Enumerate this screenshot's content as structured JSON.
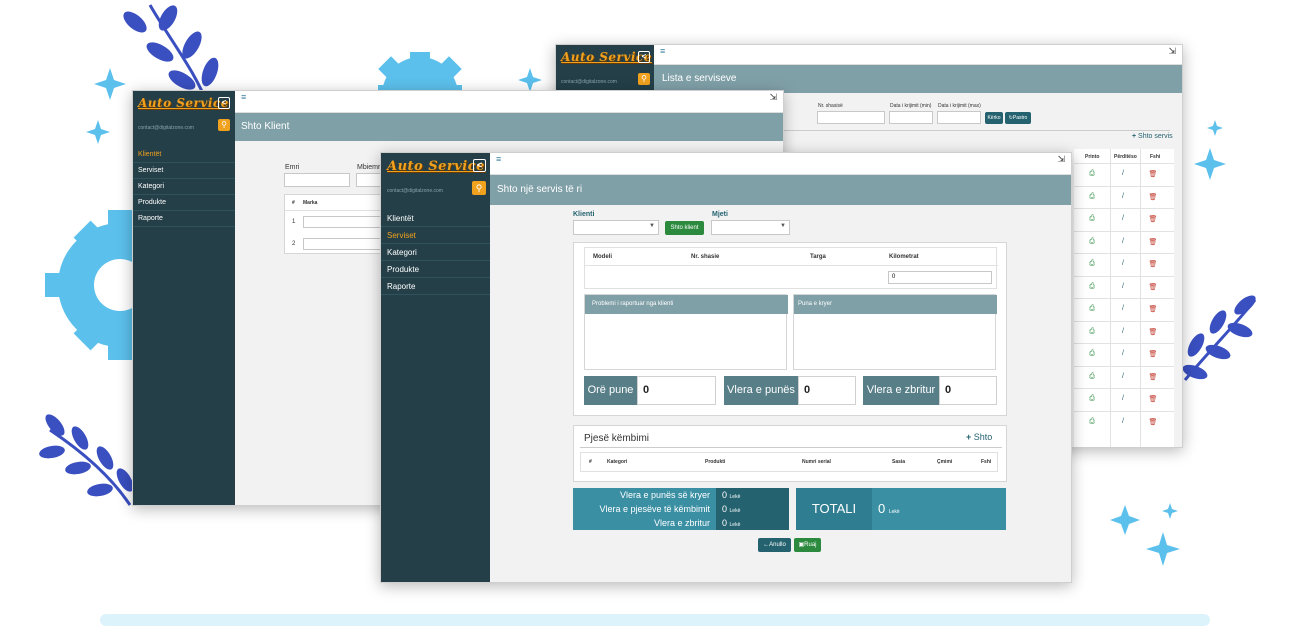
{
  "colors": {
    "sidebar": "#243f48",
    "accent_orange": "#f0a11e",
    "titlebar": "#80a0a8",
    "teal_button": "#24626f",
    "green_button": "#2b8a3e",
    "total_panel": "#3a8fa3",
    "decor_blue": "#3a4fc0",
    "decor_light": "#5cc0ec"
  },
  "brand": "Auto Service",
  "collapse_glyph": "<",
  "email": "contact@digitalzone.com",
  "search_glyph": "⚲",
  "hamburger_glyph": "≡",
  "logout_glyph": "⇲",
  "window_list": {
    "title": "Lista e serviseve",
    "filters": {
      "chassis": "Nr. shasisë",
      "date_min": "Data i krijimit (min)",
      "date_max": "Data i krijimit (max)"
    },
    "search_btn": "Kërko",
    "reset_btn": "Pastro",
    "add_link": "Shto servis",
    "columns": [
      "Printo",
      "Përditëso",
      "Fshi"
    ]
  },
  "window_client": {
    "title": "Shto Klient",
    "nav": [
      "Klientët",
      "Serviset",
      "Kategori",
      "Produkte",
      "Raporte"
    ],
    "active_nav": 0,
    "fields": {
      "name": "Emri",
      "surname": "Mbiemri"
    },
    "table_headers": [
      "#",
      "Marka"
    ],
    "rows": [
      "1",
      "2"
    ]
  },
  "window_service": {
    "title": "Shto një servis të ri",
    "nav": [
      "Klientët",
      "Serviset",
      "Kategori",
      "Produkte",
      "Raporte"
    ],
    "active_nav": 1,
    "client_label": "Klienti",
    "add_client_btn": "Shto klient",
    "vehicle_label": "Mjeti",
    "vehicle_headers": [
      "Modeli",
      "Nr. shasie",
      "Targa",
      "Kilometrat"
    ],
    "km_value": "0",
    "problem_header": "Problemi i raportuar nga klienti",
    "work_header": "Puna e kryer",
    "metrics": [
      {
        "label": "Orë pune",
        "value": "0"
      },
      {
        "label": "Vlera e punës",
        "value": "0"
      },
      {
        "label": "Vlera e zbritur",
        "value": "0"
      }
    ],
    "parts_title": "Pjesë këmbimi",
    "parts_add": "Shto",
    "parts_headers": [
      "#",
      "Kategori",
      "Produkti",
      "Numri serial",
      "Sasia",
      "Çmimi",
      "Fshi"
    ],
    "summary": [
      {
        "label": "Vlera e punës së kryer",
        "value": "0",
        "unit": "Lekë"
      },
      {
        "label": "Vlera e pjesëve të këmbimit",
        "value": "0",
        "unit": "Lekë"
      },
      {
        "label": "Vlera e zbritur",
        "value": "0",
        "unit": "Lekë"
      }
    ],
    "total_label": "TOTALI",
    "total_value": "0",
    "total_unit": "Lekë",
    "cancel_btn": "←Anullo",
    "save_btn": "Ruaj"
  }
}
